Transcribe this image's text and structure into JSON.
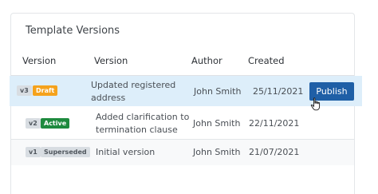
{
  "panel": {
    "title": "Template Versions"
  },
  "table": {
    "headers": [
      "Version",
      "Version",
      "Author",
      "Created"
    ],
    "rows": [
      {
        "version_tag": "v3",
        "status": "Draft",
        "description": "Updated registered address",
        "author": "John Smith",
        "created": "25/11/2021",
        "action": "Publish",
        "highlighted": true
      },
      {
        "version_tag": "v2",
        "status": "Active",
        "description": "Added clarification to termination clause",
        "author": "John Smith",
        "created": "22/11/2021"
      },
      {
        "version_tag": "v1",
        "status": "Superseded",
        "description": "Initial version",
        "author": "John Smith",
        "created": "21/07/2021"
      }
    ]
  },
  "colors": {
    "highlight_row": "#ddeefa",
    "draft_badge": "#f5a21c",
    "active_badge": "#1e8a3e",
    "superseded_badge": "#d8dde2",
    "publish_button": "#1f5fa6"
  },
  "icons": {
    "cursor": "hand-pointer-icon"
  }
}
